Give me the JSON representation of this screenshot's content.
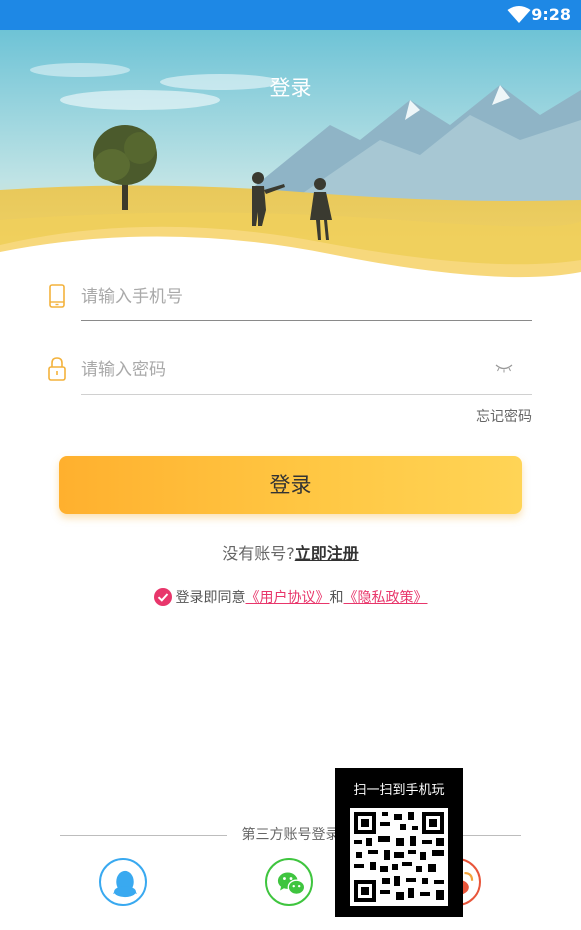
{
  "status_bar": {
    "time": "9:28",
    "icons": [
      "wifi-icon"
    ],
    "background": "#1e88e5"
  },
  "header": {
    "title": "登录"
  },
  "form": {
    "phone": {
      "placeholder": "请输入手机号",
      "icon": "phone-icon"
    },
    "password": {
      "placeholder": "请输入密码",
      "icon": "lock-icon",
      "toggle_icon": "eye-closed-icon"
    },
    "forgot_label": "忘记密码",
    "login_label": "登录"
  },
  "register": {
    "prompt": "没有账号?",
    "link_label": "立即注册"
  },
  "agreement": {
    "icon": "check-circle-icon",
    "prefix": "登录即同意",
    "user_agreement": "《用户协议》",
    "conjunction": "和",
    "privacy_policy": "《隐私政策》"
  },
  "third_party": {
    "label": "第三方账号登录",
    "providers": [
      "qq-icon",
      "wechat-icon",
      "weibo-icon"
    ]
  },
  "qr_popup": {
    "title": "扫一扫到手机玩"
  },
  "colors": {
    "accent": "#ffc743",
    "link": "#e8366b",
    "qq": "#39a9f0",
    "wechat": "#3fc53f",
    "weibo": "#e8553a"
  }
}
